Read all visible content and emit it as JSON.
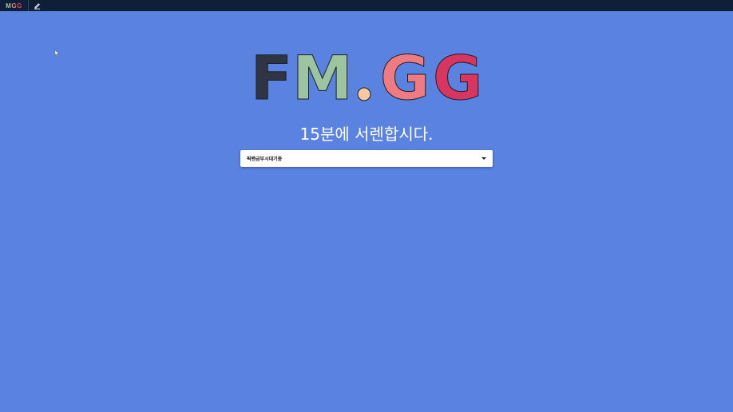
{
  "topbar": {
    "logo_parts": [
      "M",
      "G",
      "G"
    ],
    "icons": [
      "edit-icon"
    ]
  },
  "logo": {
    "letters": [
      "F",
      "M",
      ".",
      "G",
      "G"
    ],
    "colors": [
      "#2f3542",
      "#9cc49f",
      "#f8c8a0",
      "#ef7b80",
      "#d9365f"
    ]
  },
  "tagline": "15분에 서렌합시다.",
  "select": {
    "value": "픽밴금부시대기중"
  },
  "colors": {
    "background": "#5a82e0",
    "topbar": "#0f1f38"
  }
}
